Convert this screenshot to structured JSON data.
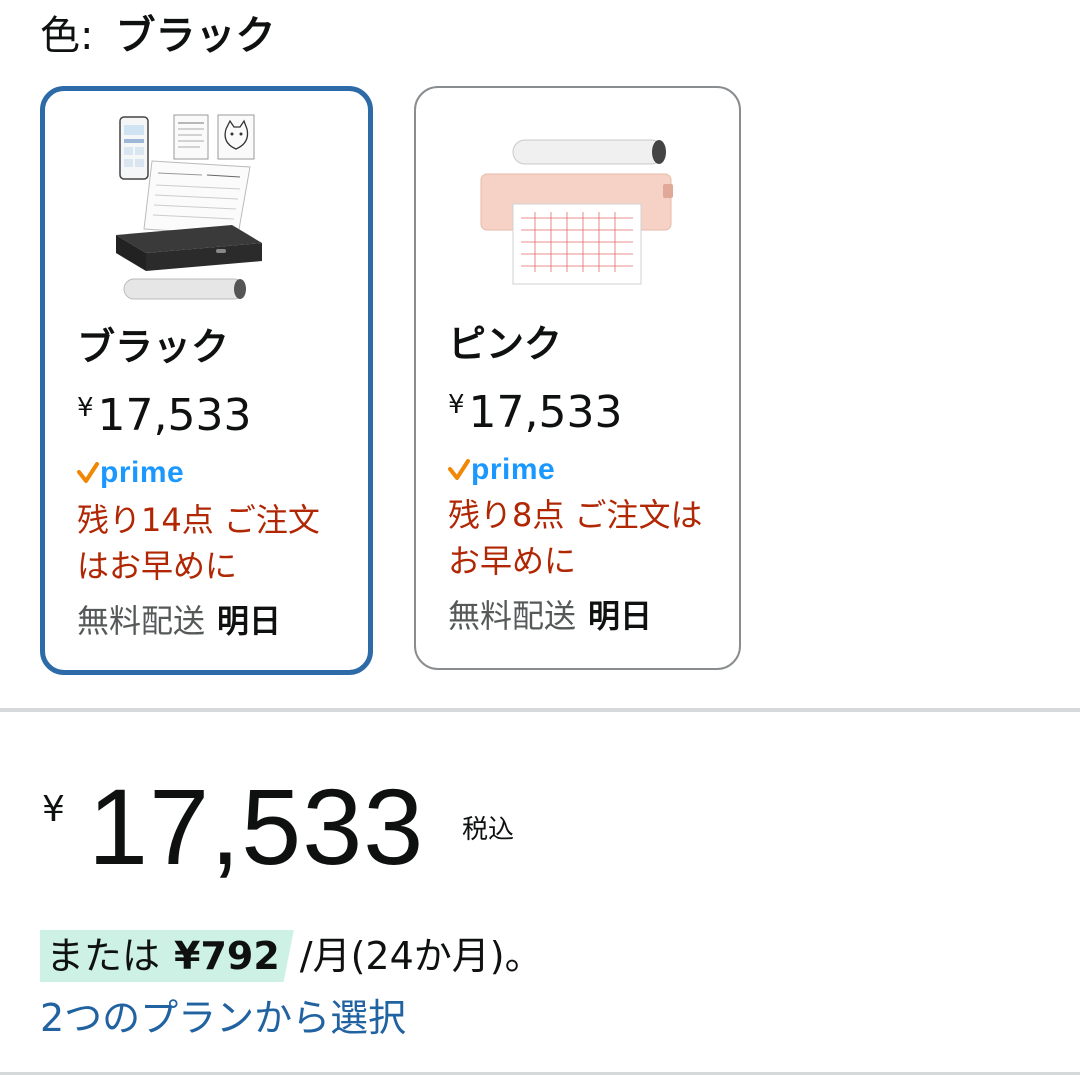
{
  "color_selector": {
    "label": "色:",
    "selected_value": "ブラック"
  },
  "swatches": [
    {
      "name": "ブラック",
      "price_symbol": "¥",
      "price": "17,533",
      "prime_label": "prime",
      "stock_text": "残り14点 ご注文はお早めに",
      "shipping_label": "無料配送",
      "shipping_day": "明日",
      "selected": true
    },
    {
      "name": "ピンク",
      "price_symbol": "¥",
      "price": "17,533",
      "prime_label": "prime",
      "stock_text": "残り8点 ご注文はお早めに",
      "shipping_label": "無料配送",
      "shipping_day": "明日",
      "selected": false
    }
  ],
  "price_block": {
    "symbol": "¥",
    "amount": "17,533",
    "tax_note": "税込"
  },
  "installment": {
    "prefix": "または",
    "amount": "¥792",
    "suffix": "/月(24か月)。"
  },
  "plan_link": "2つのプランから選択",
  "colors": {
    "selected_border": "#2d6aa8",
    "stock_red": "#b12704",
    "prime_blue": "#1a98ff",
    "prime_check": "#f08804",
    "link_blue": "#2162a1",
    "highlight_green": "#cdf1e4"
  }
}
